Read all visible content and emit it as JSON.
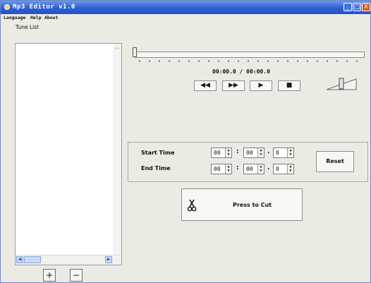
{
  "window": {
    "title": "Mp3 Editor v1.0",
    "controls": {
      "minimize": "_",
      "maximize": "□",
      "close": "X"
    }
  },
  "menu": [
    "Language",
    "Help",
    "About"
  ],
  "tune_list": {
    "label": "Tune List",
    "add_button": "+",
    "remove_button": "−"
  },
  "player": {
    "time_display": "00:00.0 / 00:00.0",
    "buttons": {
      "rewind": "◀◀",
      "fast_forward": "▶▶",
      "play": "▶",
      "stop": "■"
    },
    "position_fraction": 0,
    "volume_fraction": 0.5
  },
  "cut_panel": {
    "start_label": "Start Time",
    "end_label": "End Time",
    "start": {
      "minutes": "00",
      "seconds": "00",
      "tenths": "0"
    },
    "end": {
      "minutes": "00",
      "seconds": "00",
      "tenths": "0"
    },
    "colon": ":",
    "dot": ".",
    "reset_label": "Reset",
    "cut_label": "Press to Cut"
  },
  "icons": [
    "app-icon",
    "scissors-icon",
    "volume-icon",
    "up-arrow-icon",
    "left-arrow-icon",
    "right-arrow-icon"
  ]
}
